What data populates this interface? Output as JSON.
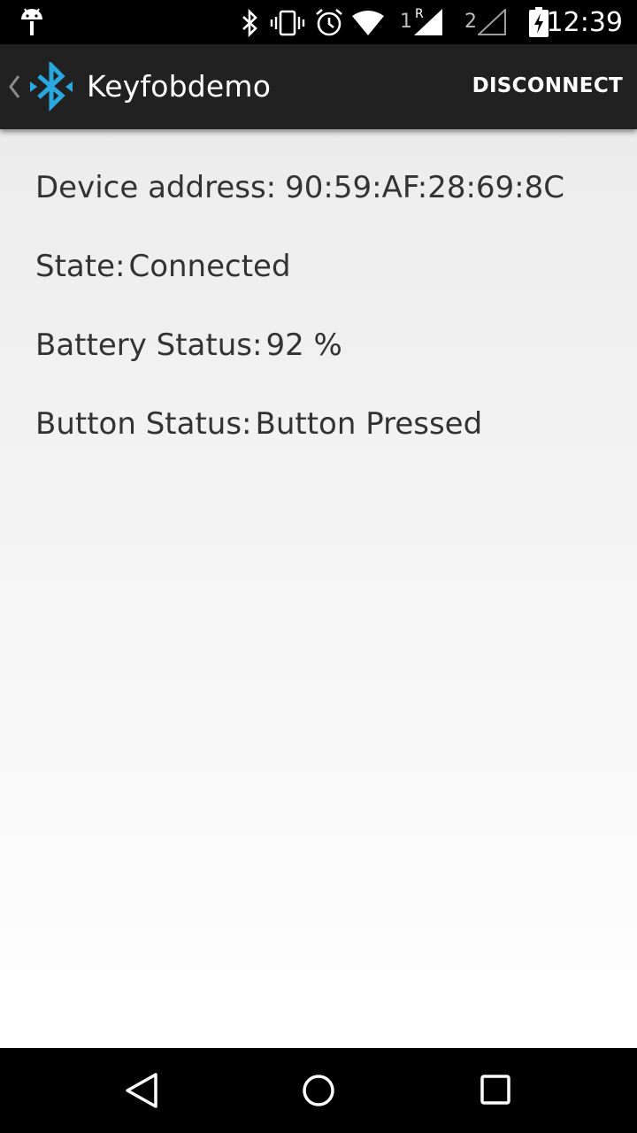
{
  "status_bar": {
    "sim1_label": "1",
    "sim1_roaming": "R",
    "sim2_label": "2",
    "time": "12:39",
    "icons": [
      "android-debug-icon",
      "bluetooth-icon",
      "vibrate-icon",
      "alarm-icon",
      "wifi-icon",
      "signal-sim1-icon",
      "signal-sim2-icon",
      "battery-charging-icon"
    ]
  },
  "action_bar": {
    "title": "Keyfobdemo",
    "app_icon": "bluetooth-icon",
    "action_label": "DISCONNECT",
    "background": "#212121",
    "accent": "#29a8e0"
  },
  "details": {
    "device_address_label": "Device address:",
    "device_address_value": "90:59:AF:28:69:8C",
    "state_label": "State:",
    "state_value": "Connected",
    "battery_label": "Battery Status:",
    "battery_value": "92 %",
    "button_label": "Button Status:",
    "button_value": "Button Pressed"
  },
  "nav_bar": {
    "icons": [
      "back-icon",
      "home-icon",
      "recents-icon"
    ]
  }
}
